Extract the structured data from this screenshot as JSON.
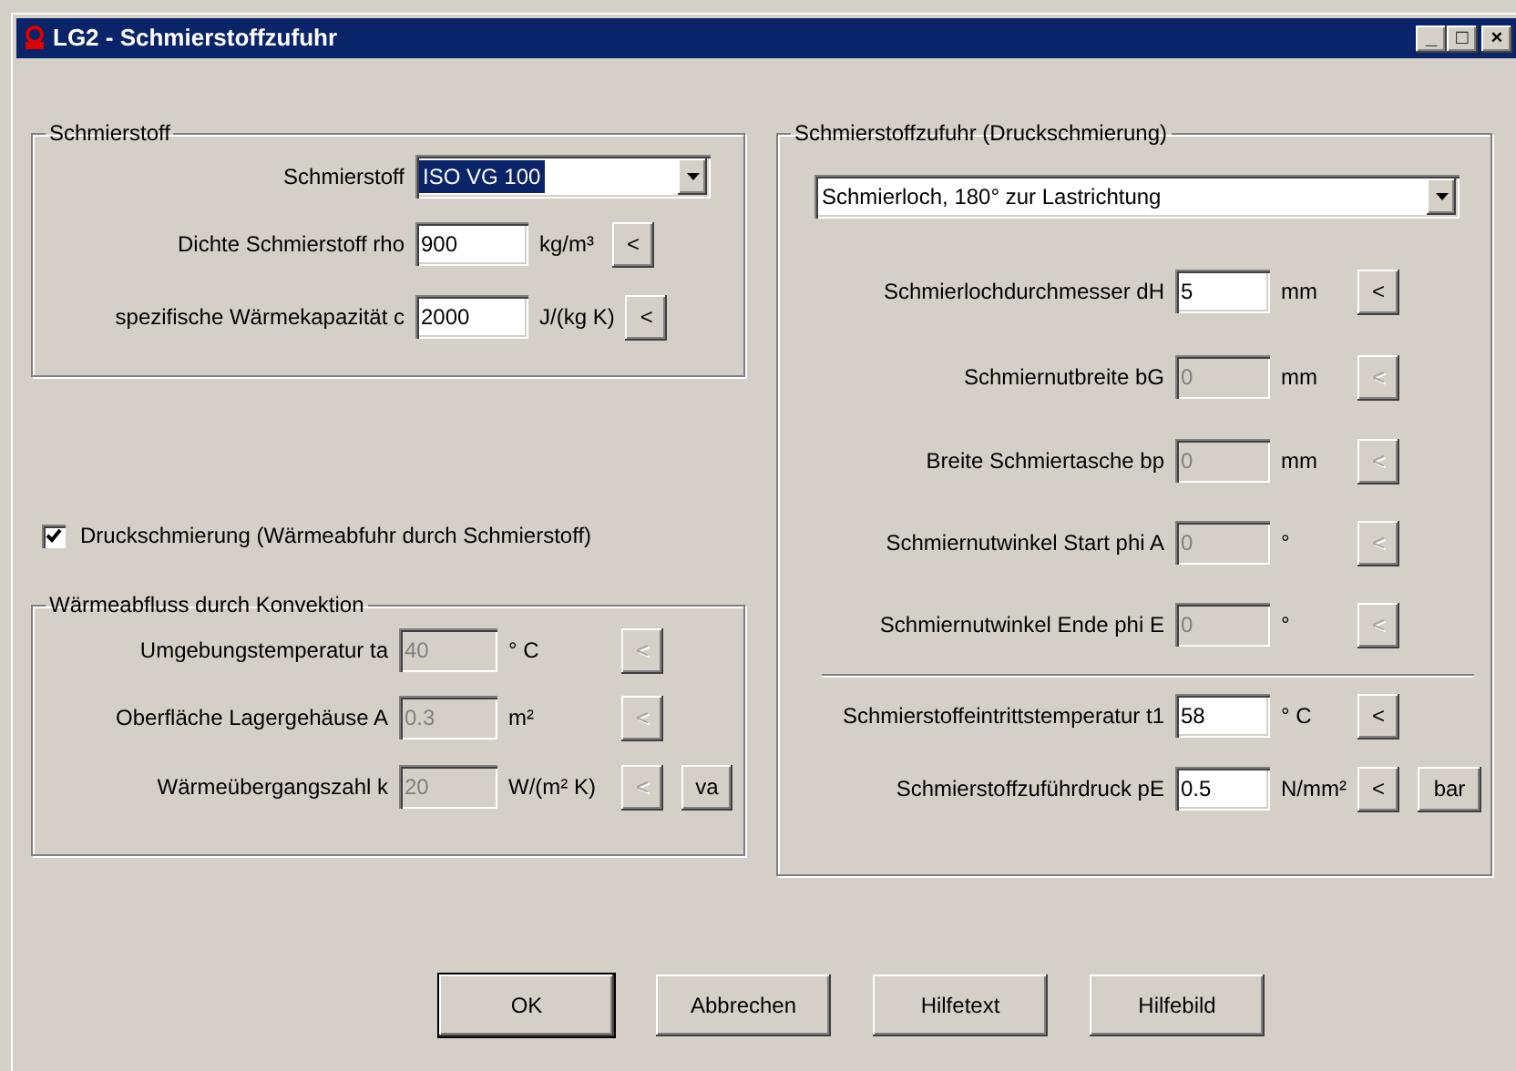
{
  "window": {
    "title": "LG2 - Schmierstoffzufuhr",
    "controls": [
      "_",
      "□",
      "×"
    ]
  },
  "lubricant_group": {
    "title": "Schmierstoff",
    "rows": [
      {
        "kind": "select",
        "label": "Schmierstoff",
        "value": "ISO VG 100",
        "highlighted": true
      },
      {
        "kind": "input",
        "label": "Dichte Schmierstoff rho",
        "value": "900",
        "unit": "kg/m³",
        "disabled": false,
        "buttons": [
          {
            "label": "<",
            "disabled": false
          }
        ]
      },
      {
        "kind": "input",
        "label": "spezifische Wärmekapazität c",
        "value": "2000",
        "unit": "J/(kg K)",
        "disabled": false,
        "buttons": [
          {
            "label": "<",
            "disabled": false
          }
        ]
      }
    ]
  },
  "pressure_lubrication": {
    "label": "Druckschmierung (Wärmeabfuhr durch Schmierstoff)",
    "checked": true
  },
  "convection_group": {
    "title": "Wärmeabfluss durch Konvektion",
    "rows": [
      {
        "kind": "input",
        "label": "Umgebungstemperatur ta",
        "value": "40",
        "unit": "° C",
        "disabled": true,
        "buttons": [
          {
            "label": "<",
            "disabled": true
          }
        ]
      },
      {
        "kind": "input",
        "label": "Oberfläche Lagergehäuse A",
        "value": "0.3",
        "unit": "m²",
        "disabled": true,
        "buttons": [
          {
            "label": "<",
            "disabled": true
          }
        ]
      },
      {
        "kind": "input",
        "label": "Wärmeübergangszahl k",
        "value": "20",
        "unit": "W/(m² K)",
        "disabled": true,
        "buttons": [
          {
            "label": "<",
            "disabled": true
          },
          {
            "label": "va",
            "disabled": false
          }
        ]
      }
    ]
  },
  "supply_group": {
    "title": "Schmierstoffzufuhr (Druckschmierung)",
    "rows": [
      {
        "kind": "select",
        "value": "Schmierloch, 180° zur Lastrichtung",
        "highlighted": false
      },
      {
        "kind": "input",
        "label": "Schmierlochdurchmesser dH",
        "value": "5",
        "unit": "mm",
        "disabled": false,
        "buttons": [
          {
            "label": "<",
            "disabled": false
          }
        ]
      },
      {
        "kind": "input",
        "label": "Schmiernutbreite bG",
        "value": "0",
        "unit": "mm",
        "disabled": true,
        "buttons": [
          {
            "label": "<",
            "disabled": true
          }
        ]
      },
      {
        "kind": "input",
        "label": "Breite Schmiertasche bp",
        "value": "0",
        "unit": "mm",
        "disabled": true,
        "buttons": [
          {
            "label": "<",
            "disabled": true
          }
        ]
      },
      {
        "kind": "input",
        "label": "Schmiernutwinkel Start phi A",
        "value": "0",
        "unit": "°",
        "disabled": true,
        "buttons": [
          {
            "label": "<",
            "disabled": true
          }
        ]
      },
      {
        "kind": "input",
        "label": "Schmiernutwinkel Ende phi E",
        "value": "0",
        "unit": "°",
        "disabled": true,
        "buttons": [
          {
            "label": "<",
            "disabled": true
          }
        ]
      },
      {
        "kind": "divider"
      },
      {
        "kind": "input",
        "label": "Schmierstoffeintrittstemperatur t1",
        "value": "58",
        "unit": "° C",
        "disabled": false,
        "buttons": [
          {
            "label": "<",
            "disabled": false
          }
        ]
      },
      {
        "kind": "input",
        "label": "Schmierstoffzuführdruck pE",
        "value": "0.5",
        "unit": "N/mm²",
        "disabled": false,
        "buttons": [
          {
            "label": "<",
            "disabled": false
          },
          {
            "label": "bar",
            "disabled": false
          }
        ]
      }
    ]
  },
  "buttons": [
    {
      "label": "OK",
      "default": true
    },
    {
      "label": "Abbrechen",
      "default": false
    },
    {
      "label": "Hilfetext",
      "default": false
    },
    {
      "label": "Hilfebild",
      "default": false
    }
  ]
}
